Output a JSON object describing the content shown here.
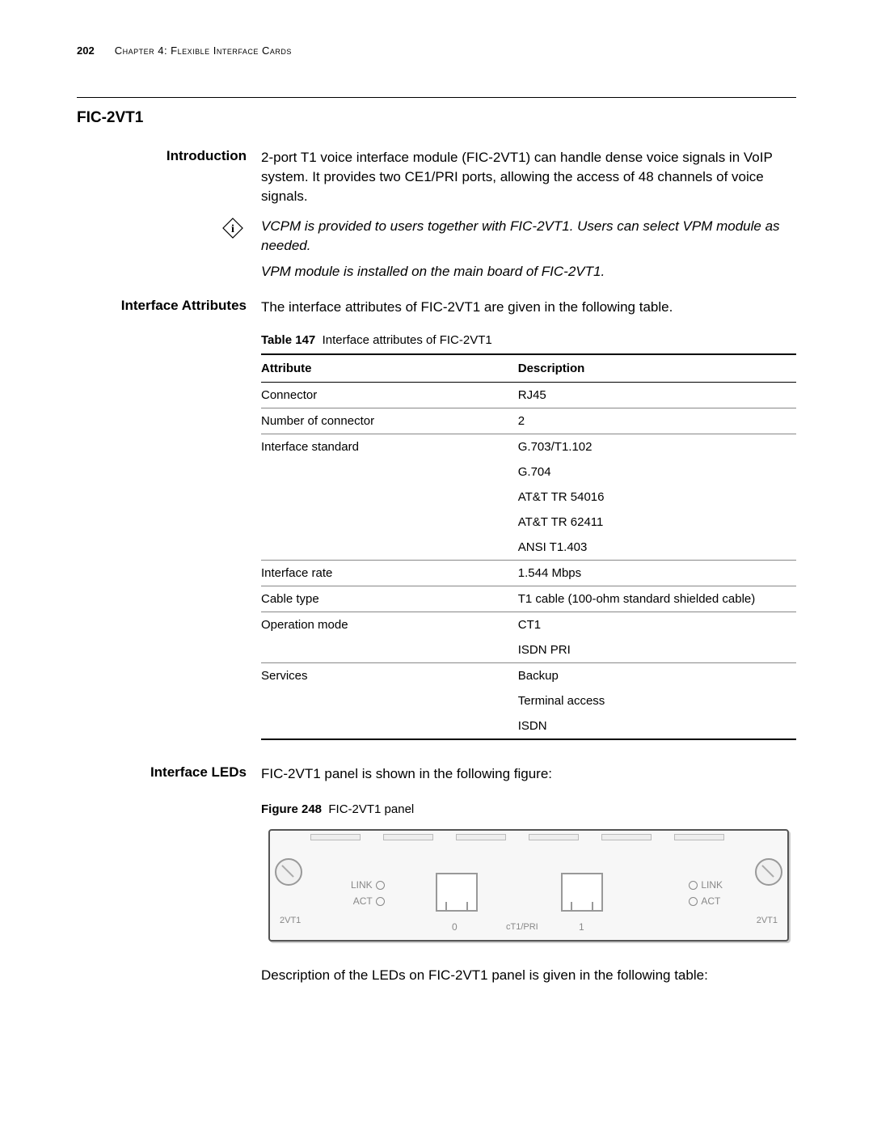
{
  "header": {
    "page_number": "202",
    "chapter": "Chapter 4: Flexible Interface Cards"
  },
  "section_title": "FIC-2VT1",
  "intro": {
    "label": "Introduction",
    "text": "2-port T1 voice interface module (FIC-2VT1) can handle dense voice signals in VoIP system. It provides two CE1/PRI ports, allowing the access of 48 channels of voice signals."
  },
  "notes": {
    "line1": "VCPM is provided to users together with FIC-2VT1. Users can select VPM module as needed.",
    "line2": "VPM module is installed on the main board of FIC-2VT1."
  },
  "attributes": {
    "label": "Interface Attributes",
    "intro": "The interface attributes of FIC-2VT1 are given in the following table.",
    "table_caption_prefix": "Table 147",
    "table_caption": "Interface attributes of FIC-2VT1",
    "headers": {
      "c1": "Attribute",
      "c2": "Description"
    },
    "rows": [
      {
        "attr": "Connector",
        "desc": "RJ45",
        "first": true
      },
      {
        "attr": "Number of connector",
        "desc": "2",
        "first": true
      },
      {
        "attr": "Interface standard",
        "desc": "G.703/T1.102",
        "first": true
      },
      {
        "attr": "",
        "desc": "G.704",
        "first": false
      },
      {
        "attr": "",
        "desc": "AT&T TR 54016",
        "first": false
      },
      {
        "attr": "",
        "desc": "AT&T TR 62411",
        "first": false
      },
      {
        "attr": "",
        "desc": "ANSI T1.403",
        "first": false
      },
      {
        "attr": "Interface rate",
        "desc": "1.544 Mbps",
        "first": true
      },
      {
        "attr": "Cable type",
        "desc": "T1 cable (100-ohm standard shielded cable)",
        "first": true
      },
      {
        "attr": "Operation mode",
        "desc": "CT1",
        "first": true
      },
      {
        "attr": "",
        "desc": "ISDN PRI",
        "first": false
      },
      {
        "attr": "Services",
        "desc": "Backup",
        "first": true
      },
      {
        "attr": "",
        "desc": "Terminal access",
        "first": false
      },
      {
        "attr": "",
        "desc": "ISDN",
        "first": false
      }
    ]
  },
  "leds": {
    "label": "Interface LEDs",
    "intro": "FIC-2VT1 panel is shown in the following figure:",
    "figure_caption_prefix": "Figure 248",
    "figure_caption": "FIC-2VT1 panel",
    "outro": "Description of the LEDs on FIC-2VT1 panel is given in the following table:"
  },
  "panel": {
    "side_label_left": "2VT1",
    "side_label_right": "2VT1",
    "led_link": "LINK",
    "led_act": "ACT",
    "port0": "0",
    "port1": "1",
    "center": "cT1/PRI"
  }
}
